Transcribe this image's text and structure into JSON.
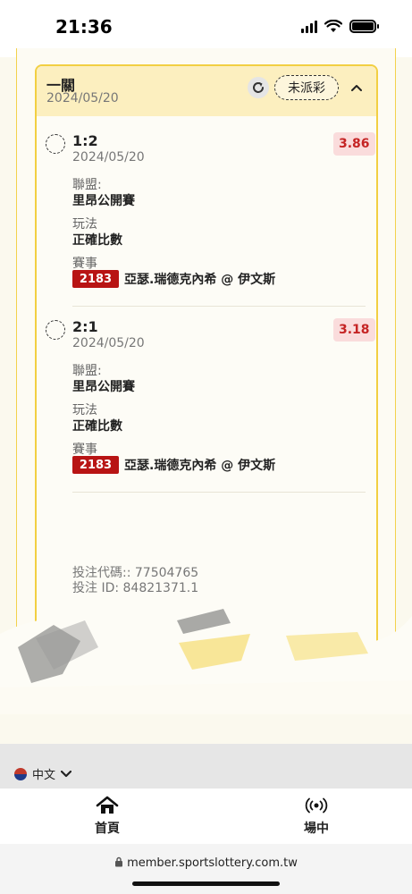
{
  "status_bar": {
    "time": "21:36"
  },
  "ticket": {
    "type": "一關",
    "date": "2024/05/20",
    "status": "未派彩",
    "bets": [
      {
        "score": "1:2",
        "date": "2024/05/20",
        "odds": "3.86",
        "league_label": "聯盟:",
        "league": "里昂公開賽",
        "play_label": "玩法",
        "play": "正確比數",
        "event_label": "賽事",
        "event_code": "2183",
        "event_name": "亞瑟.瑞德克內希 @ 伊文斯"
      },
      {
        "score": "2:1",
        "date": "2024/05/20",
        "odds": "3.18",
        "league_label": "聯盟:",
        "league": "里昂公開賽",
        "play_label": "玩法",
        "play": "正確比數",
        "event_label": "賽事",
        "event_code": "2183",
        "event_name": "亞瑟.瑞德克內希 @ 伊文斯"
      }
    ],
    "bet_code": "投注代碼:: 77504765",
    "bet_id": "投注 ID: 84821371.1"
  },
  "language": {
    "selected": "中文"
  },
  "bottom_nav": {
    "home_label": "首頁",
    "live_label": "場中"
  },
  "browser": {
    "url": "member.sportslottery.com.tw"
  },
  "icons": {
    "refresh": "refresh-icon",
    "collapse": "chevron-up-icon",
    "home": "home-icon",
    "live": "broadcast-icon",
    "lock": "lock-icon",
    "flag": "taiwan-flag-icon"
  },
  "colors": {
    "accent_yellow": "#f2cf42",
    "header_bg": "#fcefbf",
    "odds_red": "#c52424",
    "event_code_bg": "#b81414"
  }
}
